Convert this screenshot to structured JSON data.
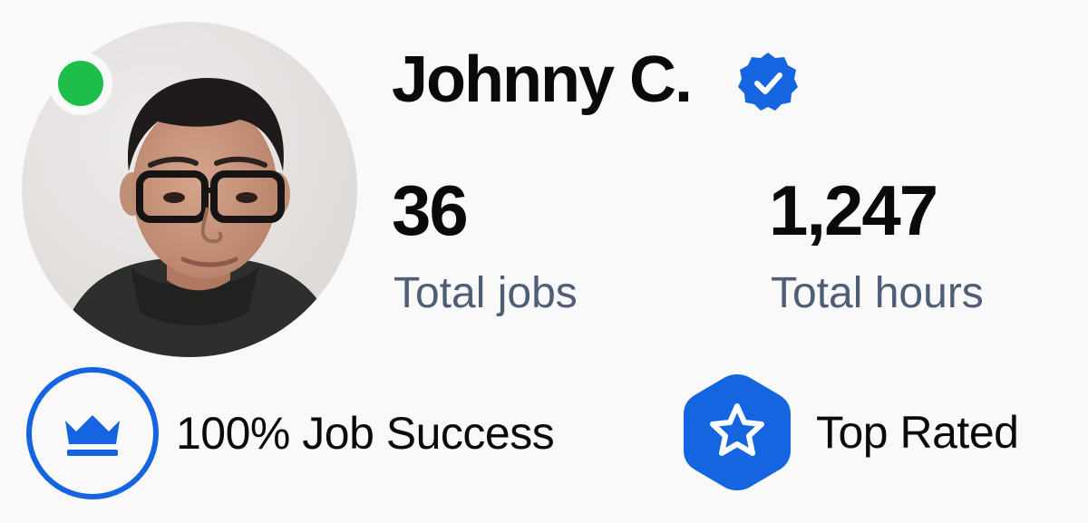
{
  "profile": {
    "name": "Johnny C.",
    "online": true,
    "verified": true,
    "avatar_icon": "user-photo"
  },
  "stats": {
    "total_jobs": {
      "value": "36",
      "label": "Total jobs"
    },
    "total_hours": {
      "value": "1,247",
      "label": "Total hours"
    }
  },
  "badges": {
    "job_success": {
      "label": "100% Job Success",
      "icon": "crown-icon"
    },
    "top_rated": {
      "label": "Top Rated",
      "icon": "star-icon"
    }
  },
  "colors": {
    "accent_blue": "#1565e0",
    "online_green": "#1dbf4a",
    "muted_label": "#4f5d75",
    "text": "#0a0a0a",
    "background": "#f9f9f9"
  }
}
